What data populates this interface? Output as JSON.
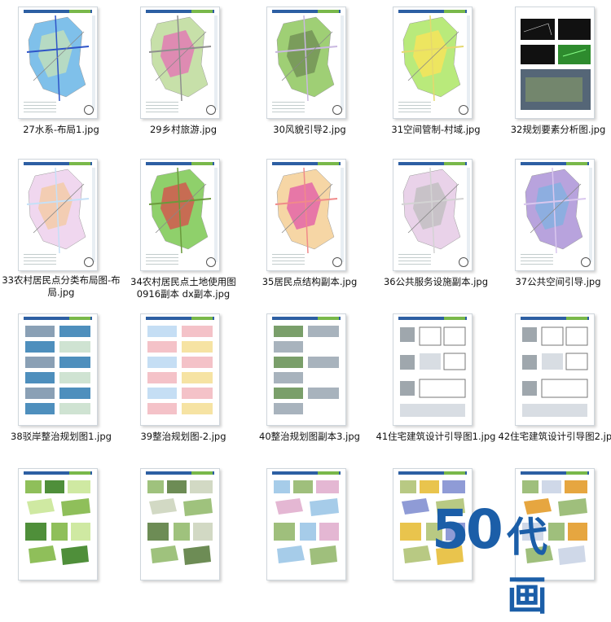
{
  "files": [
    {
      "name": "27水系-布局1.jpg",
      "style": "map",
      "colors": [
        "#7fc0ea",
        "#c8e3b5",
        "#2f55c8"
      ]
    },
    {
      "name": "29乡村旅游.jpg",
      "style": "map",
      "colors": [
        "#c7e0a9",
        "#e56fb5",
        "#8f8f8f"
      ]
    },
    {
      "name": "30风貌引导2.jpg",
      "style": "map",
      "colors": [
        "#9fcf75",
        "#6e8b53",
        "#c9b8e0"
      ]
    },
    {
      "name": "31空间管制-村域.jpg",
      "style": "map",
      "colors": [
        "#b9ea7b",
        "#ffe357",
        "#e5d86e"
      ]
    },
    {
      "name": "32规划要素分析图.jpg",
      "style": "dark",
      "colors": [
        "#111111",
        "#2e8b2e",
        "#556677"
      ]
    },
    {
      "name": "33农村居民点分类布局图-布局.jpg",
      "style": "map",
      "colors": [
        "#f0d7ef",
        "#f4c99f",
        "#c5e0f7"
      ]
    },
    {
      "name": "34农村居民点土地使用图0916副本 dx副本.jpg",
      "style": "map",
      "colors": [
        "#8fd06b",
        "#d94b4b",
        "#6a9a3c"
      ]
    },
    {
      "name": "35居民点结构副本.jpg",
      "style": "map",
      "colors": [
        "#f6d6a5",
        "#e257a8",
        "#f08a8a"
      ]
    },
    {
      "name": "36公共服务设施副本.jpg",
      "style": "map",
      "colors": [
        "#e9d2e9",
        "#bcbcbc",
        "#d3d3d3"
      ]
    },
    {
      "name": "37公共空间引导.jpg",
      "style": "map",
      "colors": [
        "#b8a3dd",
        "#7fb2e0",
        "#d9c7ee"
      ]
    },
    {
      "name": "38驳岸整治规划图1.jpg",
      "style": "photos",
      "colors": [
        "#4e8fbd",
        "#cfe3d2",
        "#8aa0b5"
      ]
    },
    {
      "name": "39整治规划图-2.jpg",
      "style": "photos",
      "colors": [
        "#f4c2c8",
        "#f6e3a3",
        "#c5def4"
      ]
    },
    {
      "name": "40整治规划图副本3.jpg",
      "style": "photos",
      "colors": [
        "#a8b3bd",
        "#ffffff",
        "#7a9f6a"
      ]
    },
    {
      "name": "41住宅建筑设计引导图1.jpg",
      "style": "arch",
      "colors": [
        "#d8dde3",
        "#9fa7ad",
        "#ffffff"
      ]
    },
    {
      "name": "42住宅建筑设计引导图2.jpg",
      "style": "arch",
      "colors": [
        "#d8dde3",
        "#9fa7ad",
        "#ffffff"
      ]
    },
    {
      "name": "",
      "style": "photos2",
      "colors": [
        "#8fbf5a",
        "#cfe9a2",
        "#4f8f3a"
      ]
    },
    {
      "name": "",
      "style": "photos2",
      "colors": [
        "#9fc27d",
        "#d2d9c4",
        "#6d8c55"
      ]
    },
    {
      "name": "",
      "style": "photos2",
      "colors": [
        "#a6cce9",
        "#e4b7d3",
        "#9fbf7c"
      ]
    },
    {
      "name": "",
      "style": "photos2",
      "colors": [
        "#b8c983",
        "#8f9bd6",
        "#e9c44d"
      ]
    },
    {
      "name": "",
      "style": "photos2",
      "colors": [
        "#9fbf7c",
        "#e6a640",
        "#cfd8e8"
      ]
    }
  ],
  "watermark": {
    "number": "50",
    "text": "代画",
    "color": "#1b5ea8"
  }
}
